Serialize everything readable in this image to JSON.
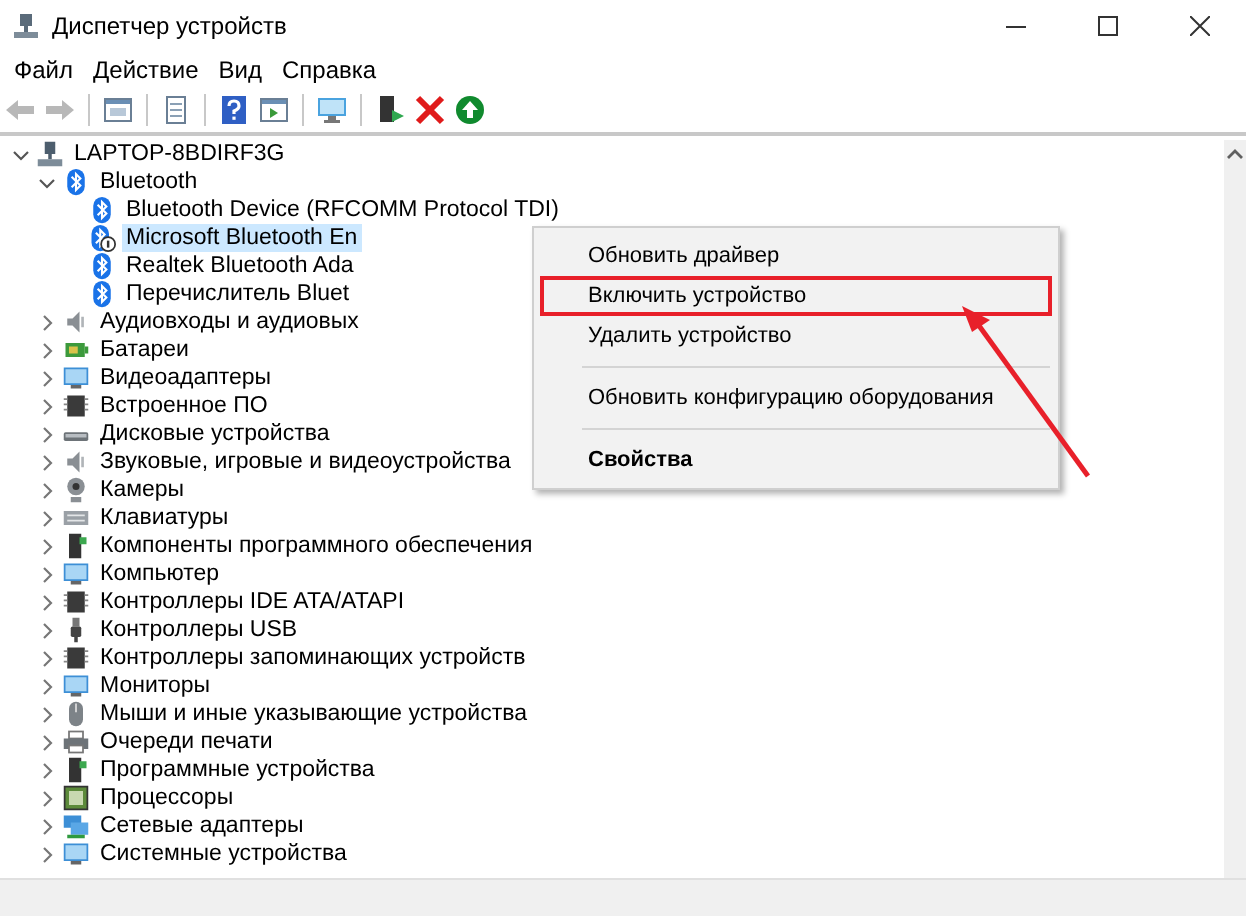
{
  "window": {
    "title": "Диспетчер устройств"
  },
  "menu": [
    "Файл",
    "Действие",
    "Вид",
    "Справка"
  ],
  "toolbar": [
    {
      "kind": "back",
      "disabled": true
    },
    {
      "kind": "forward",
      "disabled": true
    },
    {
      "kind": "sep"
    },
    {
      "kind": "pane"
    },
    {
      "kind": "sep"
    },
    {
      "kind": "props"
    },
    {
      "kind": "sep"
    },
    {
      "kind": "help"
    },
    {
      "kind": "action"
    },
    {
      "kind": "sep"
    },
    {
      "kind": "scan"
    },
    {
      "kind": "sep"
    },
    {
      "kind": "driver"
    },
    {
      "kind": "remove"
    },
    {
      "kind": "enable"
    }
  ],
  "tree": [
    {
      "label": "LAPTOP-8BDIRF3G",
      "kind": "computer",
      "expanded": true,
      "selected": false,
      "children": [
        {
          "label": "Bluetooth",
          "kind": "bluetooth",
          "expanded": true,
          "selected": false,
          "children": [
            {
              "label": "Bluetooth Device (RFCOMM Protocol TDI)",
              "kind": "bluetooth",
              "selected": false
            },
            {
              "label": "Microsoft Bluetooth En",
              "kind": "bluetooth-disabled",
              "selected": true
            },
            {
              "label": "Realtek Bluetooth Ada",
              "kind": "bluetooth",
              "selected": false
            },
            {
              "label": "Перечислитель Bluet",
              "kind": "bluetooth",
              "selected": false
            }
          ]
        },
        {
          "label": "Аудиовходы и аудиовых",
          "kind": "speaker",
          "expanded": false,
          "selected": false
        },
        {
          "label": "Батареи",
          "kind": "battery",
          "expanded": false,
          "selected": false
        },
        {
          "label": "Видеоадаптеры",
          "kind": "display",
          "expanded": false,
          "selected": false
        },
        {
          "label": "Встроенное ПО",
          "kind": "chip",
          "expanded": false,
          "selected": false
        },
        {
          "label": "Дисковые устройства",
          "kind": "disk",
          "expanded": false,
          "selected": false
        },
        {
          "label": "Звуковые, игровые и видеоустройства",
          "kind": "speaker",
          "expanded": false,
          "selected": false
        },
        {
          "label": "Камеры",
          "kind": "camera",
          "expanded": false,
          "selected": false
        },
        {
          "label": "Клавиатуры",
          "kind": "keyboard",
          "expanded": false,
          "selected": false
        },
        {
          "label": "Компоненты программного обеспечения",
          "kind": "device",
          "expanded": false,
          "selected": false
        },
        {
          "label": "Компьютер",
          "kind": "display",
          "expanded": false,
          "selected": false
        },
        {
          "label": "Контроллеры IDE ATA/ATAPI",
          "kind": "chip",
          "expanded": false,
          "selected": false
        },
        {
          "label": "Контроллеры USB",
          "kind": "usb",
          "expanded": false,
          "selected": false
        },
        {
          "label": "Контроллеры запоминающих устройств",
          "kind": "chip",
          "expanded": false,
          "selected": false
        },
        {
          "label": "Мониторы",
          "kind": "display",
          "expanded": false,
          "selected": false
        },
        {
          "label": "Мыши и иные указывающие устройства",
          "kind": "mouse",
          "expanded": false,
          "selected": false
        },
        {
          "label": "Очереди печати",
          "kind": "printer",
          "expanded": false,
          "selected": false
        },
        {
          "label": "Программные устройства",
          "kind": "device",
          "expanded": false,
          "selected": false
        },
        {
          "label": "Процессоры",
          "kind": "cpu",
          "expanded": false,
          "selected": false
        },
        {
          "label": "Сетевые адаптеры",
          "kind": "network",
          "expanded": false,
          "selected": false
        },
        {
          "label": "Системные устройства",
          "kind": "display",
          "expanded": false,
          "selected": false
        }
      ]
    }
  ],
  "context_menu": [
    {
      "kind": "item",
      "label": "Обновить драйвер",
      "highlighted": false,
      "default": false
    },
    {
      "kind": "item",
      "label": "Включить устройство",
      "highlighted": true,
      "default": false
    },
    {
      "kind": "item",
      "label": "Удалить устройство",
      "highlighted": false,
      "default": false
    },
    {
      "kind": "separator"
    },
    {
      "kind": "item",
      "label": "Обновить конфигурацию оборудования",
      "highlighted": false,
      "default": false
    },
    {
      "kind": "separator"
    },
    {
      "kind": "item",
      "label": "Свойства",
      "highlighted": false,
      "default": true
    }
  ]
}
